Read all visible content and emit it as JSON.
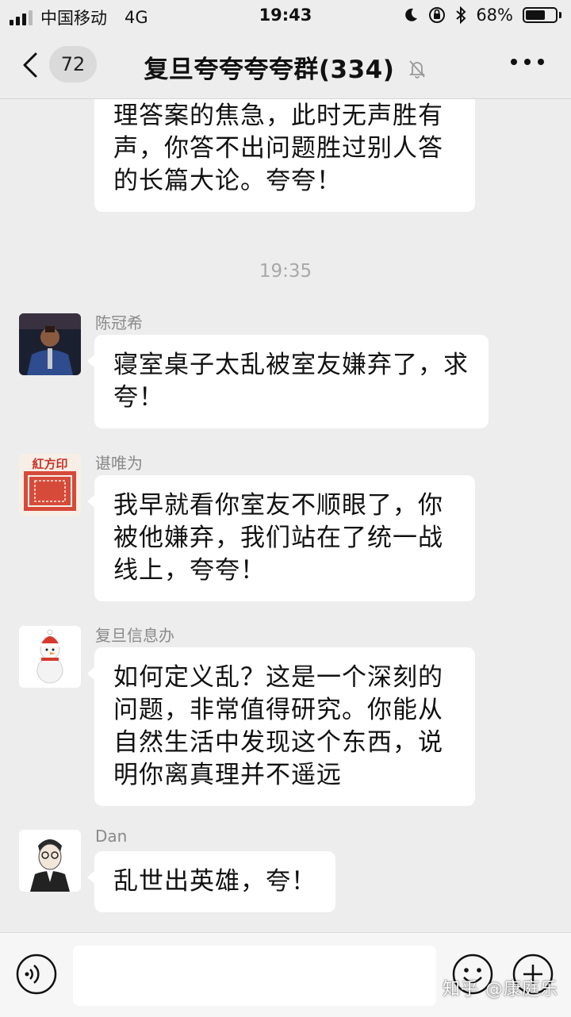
{
  "status_bar": {
    "carrier": "中国移动",
    "network": "4G",
    "time": "19:43",
    "battery_text": "68%",
    "battery_level": 0.68
  },
  "nav": {
    "unread_count": "72",
    "title": "复旦夸夸夸夸群(334)"
  },
  "messages": {
    "first_text": "以及想去想夸都绍不出一个合理答案的焦急，此时无声胜有声，你答不出问题胜过别人答的长篇大论。夸夸！",
    "timestamp": "19:35",
    "m1": {
      "sender": "陈冠希",
      "text": "寝室桌子太乱被室友嫌弃了，求夸！"
    },
    "m2": {
      "sender": "谌唯为",
      "text": "我早就看你室友不顺眼了，你被他嫌弃，我们站在了统一战线上，夸夸！",
      "avatar_text": "紅方印"
    },
    "m3": {
      "sender": "复旦信息办",
      "text": "如何定义乱？这是一个深刻的问题，非常值得研究。你能从自然生活中发现这个东西，说明你离真理并不遥远"
    },
    "m4": {
      "sender": "Dan",
      "text": "乱世出英雄，夸！"
    }
  },
  "input": {
    "value": "",
    "placeholder": ""
  },
  "watermark": "知乎 @康庭乐",
  "colors": {
    "background": "#ededed",
    "bubble": "#ffffff",
    "timestamp": "#a8a8a8",
    "sender": "#8a8a8a"
  }
}
